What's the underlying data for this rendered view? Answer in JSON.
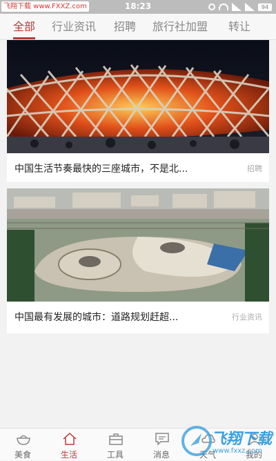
{
  "status": {
    "watermark": "飞翔下载 www.FXXZ.com",
    "time": "18:23",
    "battery": "94"
  },
  "tabs": [
    {
      "label": "全部",
      "active": true
    },
    {
      "label": "行业资讯"
    },
    {
      "label": "招聘"
    },
    {
      "label": "旅行社加盟"
    },
    {
      "label": "转让"
    }
  ],
  "articles": [
    {
      "title": "中国生活节奏最快的三座城市，不是北...",
      "tag": "招聘"
    },
    {
      "title": "中国最有发展的城市：道路规划赶超...",
      "tag": "行业资讯"
    }
  ],
  "bottom_nav": [
    {
      "label": "美食",
      "icon": "bowl-icon"
    },
    {
      "label": "生活",
      "icon": "home-icon",
      "active": true
    },
    {
      "label": "工具",
      "icon": "toolbox-icon"
    },
    {
      "label": "消息",
      "icon": "message-icon"
    },
    {
      "label": "天气",
      "icon": "weather-icon"
    },
    {
      "label": "我的",
      "icon": "user-icon"
    }
  ],
  "overlay_watermark": {
    "text": "飞翔下载",
    "url": "www.fxxz.com"
  },
  "colors": {
    "accent": "#b83a3a",
    "tag": "#aaaaaa"
  }
}
